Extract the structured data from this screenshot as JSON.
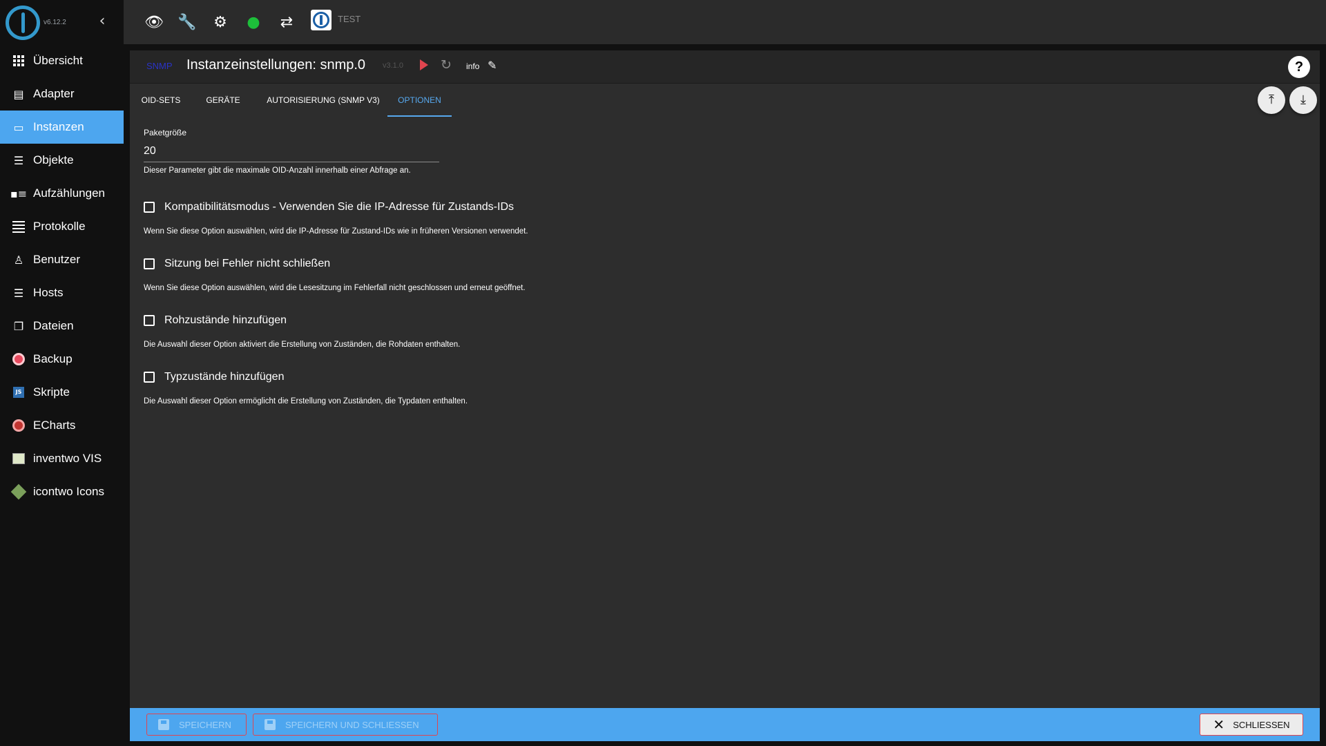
{
  "sidebar": {
    "version": "v6.12.2",
    "items": [
      {
        "label": "Übersicht",
        "icon": "grid-icon"
      },
      {
        "label": "Adapter",
        "icon": "store-icon"
      },
      {
        "label": "Instanzen",
        "icon": "instances-icon",
        "active": true
      },
      {
        "label": "Objekte",
        "icon": "list-icon"
      },
      {
        "label": "Aufzählungen",
        "icon": "enum-icon"
      },
      {
        "label": "Protokolle",
        "icon": "log-icon"
      },
      {
        "label": "Benutzer",
        "icon": "user-icon"
      },
      {
        "label": "Hosts",
        "icon": "hosts-icon"
      },
      {
        "label": "Dateien",
        "icon": "files-icon"
      },
      {
        "label": "Backup",
        "icon": "backup-icon"
      },
      {
        "label": "Skripte",
        "icon": "js-icon"
      },
      {
        "label": "ECharts",
        "icon": "echarts-icon"
      },
      {
        "label": "inventwo VIS",
        "icon": "vis-icon"
      },
      {
        "label": "icontwo Icons",
        "icon": "icons-icon"
      }
    ]
  },
  "topbar": {
    "test_label": "TEST"
  },
  "header": {
    "adapter": "SNMP",
    "title": "Instanzeinstellungen: snmp.0",
    "version": "v3.1.0",
    "info_label": "info"
  },
  "tabs": [
    "OID-SETS",
    "GERÄTE",
    "AUTORISIERUNG (SNMP V3)",
    "OPTIONEN"
  ],
  "active_tab": "OPTIONEN",
  "options": {
    "packet_size": {
      "label": "Paketgröße",
      "value": "20",
      "help": "Dieser Parameter gibt die maximale OID-Anzahl innerhalb einer Abfrage an."
    },
    "checks": [
      {
        "label": "Kompatibilitätsmodus - Verwenden Sie die IP-Adresse für Zustands-IDs",
        "help": "Wenn Sie diese Option auswählen, wird die IP-Adresse für Zustand-IDs wie in früheren Versionen verwendet.",
        "checked": false
      },
      {
        "label": "Sitzung bei Fehler nicht schließen",
        "help": "Wenn Sie diese Option auswählen, wird die Lesesitzung im Fehlerfall nicht geschlossen und erneut geöffnet.",
        "checked": false
      },
      {
        "label": "Rohzustände hinzufügen",
        "help": "Die Auswahl dieser Option aktiviert die Erstellung von Zuständen, die Rohdaten enthalten.",
        "checked": false
      },
      {
        "label": "Typzustände hinzufügen",
        "help": "Die Auswahl dieser Option ermöglicht die Erstellung von Zuständen, die Typdaten enthalten.",
        "checked": false
      }
    ]
  },
  "footer": {
    "save": "SPEICHERN",
    "save_close": "SPEICHERN UND SCHLIESSEN",
    "close": "SCHLIESSEN"
  },
  "colors": {
    "accent": "#4da6ef",
    "danger": "#e0454f",
    "panel": "#2d2d2d"
  }
}
